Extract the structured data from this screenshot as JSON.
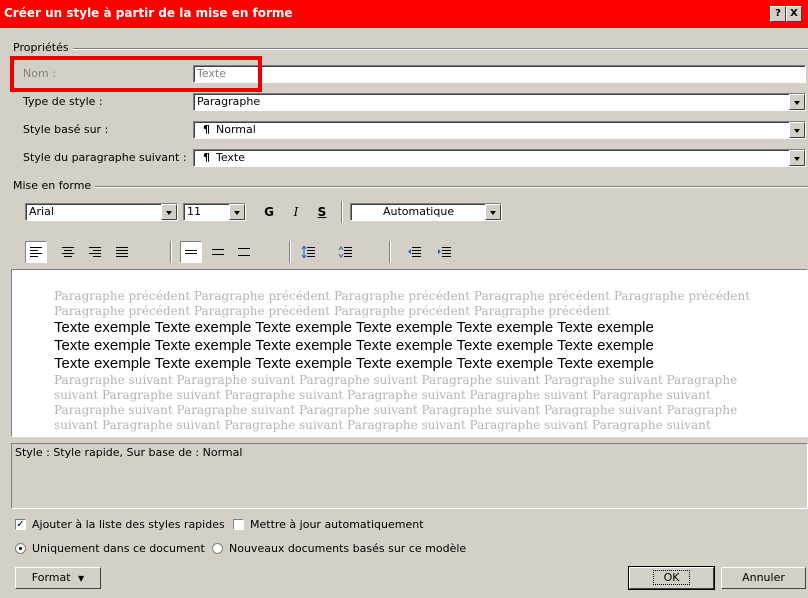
{
  "window": {
    "title": "Créer un style à partir de la mise en forme",
    "help_btn": "?",
    "close_btn": "X"
  },
  "properties": {
    "group_label": "Propriétés",
    "name_label": "Nom :",
    "name_value": "Texte",
    "style_type_label": "Type de style :",
    "style_type_value": "Paragraphe",
    "based_on_label": "Style basé sur :",
    "based_on_value": "Normal",
    "next_para_label": "Style du paragraphe suivant :",
    "next_para_value": "Texte"
  },
  "formatting": {
    "group_label": "Mise en forme",
    "font": "Arial",
    "size": "11",
    "bold": "G",
    "italic": "I",
    "underline": "S",
    "color": "Automatique"
  },
  "preview": {
    "prev_lines": [
      "Paragraphe précédent Paragraphe précédent Paragraphe précédent Paragraphe précédent Paragraphe précédent",
      "Paragraphe précédent Paragraphe précédent Paragraphe précédent Paragraphe précédent"
    ],
    "sample_lines": [
      "Texte exemple Texte exemple Texte exemple Texte exemple Texte exemple Texte exemple",
      "Texte exemple Texte exemple Texte exemple Texte exemple Texte exemple Texte exemple",
      "Texte exemple Texte exemple Texte exemple Texte exemple Texte exemple Texte exemple"
    ],
    "next_lines": [
      "Paragraphe suivant Paragraphe suivant Paragraphe suivant Paragraphe suivant Paragraphe suivant Paragraphe",
      "suivant Paragraphe suivant Paragraphe suivant Paragraphe suivant Paragraphe suivant Paragraphe suivant",
      "Paragraphe suivant Paragraphe suivant Paragraphe suivant Paragraphe suivant Paragraphe suivant Paragraphe",
      "suivant Paragraphe suivant Paragraphe suivant Paragraphe suivant Paragraphe suivant Paragraphe suivant"
    ]
  },
  "description": "Style : Style rapide, Sur base de : Normal",
  "options": {
    "add_quick": "Ajouter à la liste des styles rapides",
    "auto_update": "Mettre à jour automatiquement",
    "only_doc": "Uniquement dans ce document",
    "new_docs": "Nouveaux documents basés sur ce modèle"
  },
  "buttons": {
    "format": "Format",
    "ok": "OK",
    "cancel": "Annuler"
  }
}
